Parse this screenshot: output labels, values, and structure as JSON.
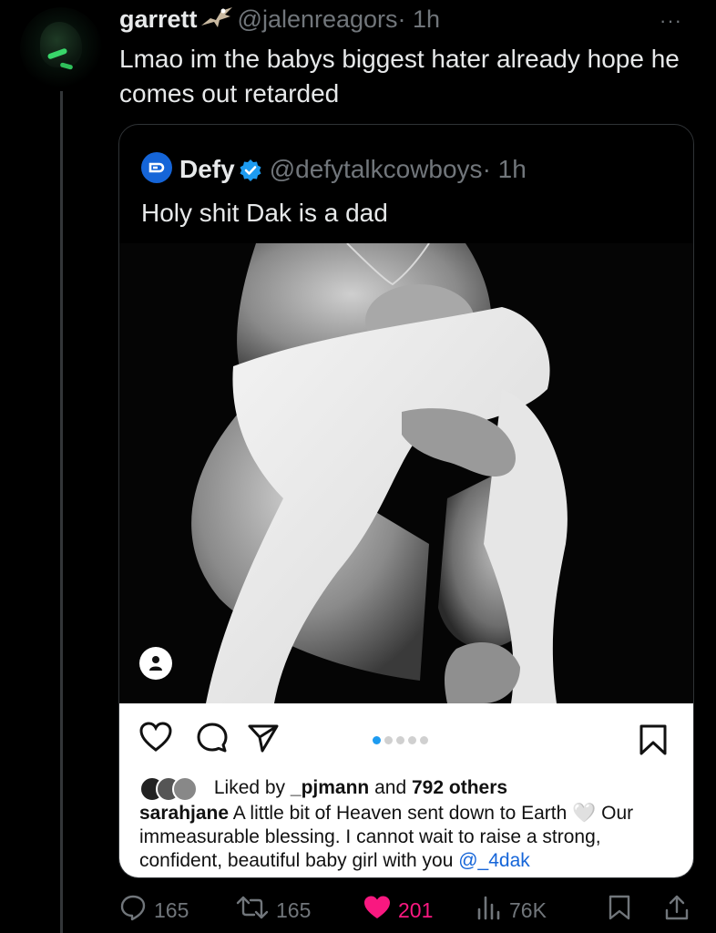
{
  "tweet": {
    "author_name": "garrett",
    "author_handle": "@jalenreagors",
    "timestamp": "· 1h",
    "more": "···",
    "text": "Lmao im the babys biggest hater already hope he comes out retarded"
  },
  "quote": {
    "author_name": "Defy",
    "author_handle": "@defytalkcowboys",
    "timestamp": "· 1h",
    "text": "Holy shit Dak is a dad",
    "instagram": {
      "liked_by_prefix": "Liked by",
      "liked_by_user": "_pjmann",
      "liked_by_and": "and",
      "liked_by_others": "792 others",
      "caption_user": "sarahjane",
      "caption_text": "A little bit of Heaven sent down to Earth 🤍 Our immeasurable blessing. I cannot wait to raise a strong, confident, beautiful baby girl with you",
      "caption_mention": "@_4dak",
      "carousel_count": 5,
      "carousel_active": 1
    }
  },
  "actions": {
    "replies": "165",
    "retweets": "165",
    "likes": "201",
    "views": "76K"
  },
  "colors": {
    "background": "#000000",
    "muted": "#71767b",
    "like_pink": "#f91880",
    "verified_blue": "#1d9bf0"
  },
  "icons": [
    "eagle-icon",
    "more-icon",
    "defy-logo-icon",
    "verified-badge-icon",
    "person-tag-icon",
    "heart-outline-icon",
    "comment-icon",
    "share-send-icon",
    "bookmark-icon",
    "reply-icon",
    "retweet-icon",
    "heart-filled-icon",
    "views-chart-icon",
    "bookmark-icon",
    "share-icon"
  ]
}
